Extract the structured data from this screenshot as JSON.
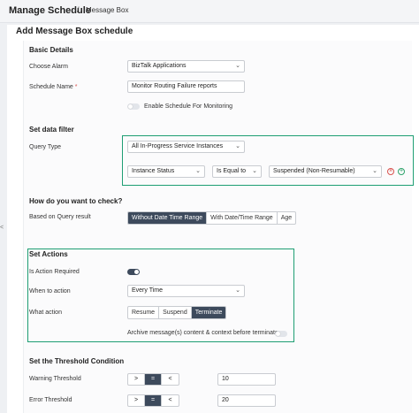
{
  "header": {
    "title": "Manage Schedule",
    "separator": "/",
    "subtitle": "Message Box"
  },
  "page_title": "Add Message Box schedule",
  "basic": {
    "title": "Basic Details",
    "choose_alarm_label": "Choose Alarm",
    "choose_alarm_value": "BizTalk Applications",
    "schedule_name_label": "Schedule Name",
    "required_mark": "*",
    "schedule_name_value": "Monitor Routing Failure reports",
    "enable_label": "Enable Schedule For Monitoring"
  },
  "filter": {
    "title": "Set data filter",
    "query_type_label": "Query Type",
    "query_type_value": "All In-Progress Service Instances",
    "field_value": "Instance Status",
    "operator_value": "Is Equal to",
    "match_value": "Suspended (Non-Resumable)"
  },
  "check": {
    "title": "How do you want to check?",
    "based_on_label": "Based on Query result",
    "options": [
      "Without Date Time Range",
      "With Date/Time Range",
      "Age"
    ]
  },
  "actions": {
    "title": "Set Actions",
    "required_label": "Is Action Required",
    "when_label": "When to action",
    "when_value": "Every Time",
    "what_label": "What action",
    "options": [
      "Resume",
      "Suspend",
      "Terminate"
    ],
    "archive_label": "Archive message(s) content & context before terminate"
  },
  "threshold": {
    "title": "Set the Threshold Condition",
    "warning_label": "Warning Threshold",
    "warning_value": "10",
    "error_label": "Error Threshold",
    "error_value": "20",
    "operators": [
      ">",
      "=",
      "<"
    ]
  },
  "side_glyph": "<",
  "colors": {
    "accent": "#1e9e73",
    "selected": "#3d4a5c",
    "remove": "#d9534f",
    "add": "#2ea36b"
  },
  "icons": {
    "remove": "remove-circle-icon",
    "add": "add-circle-icon",
    "chevron": "chevron-down-icon"
  }
}
